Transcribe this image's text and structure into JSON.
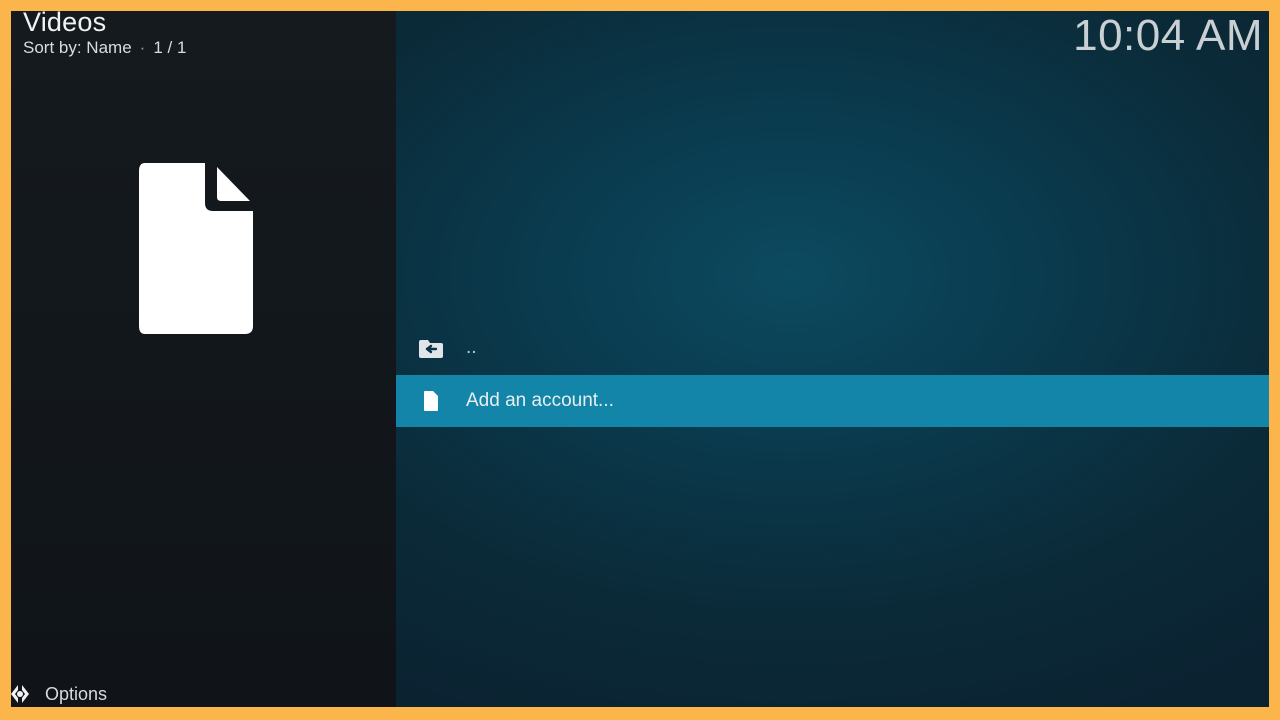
{
  "header": {
    "title": "Videos",
    "sort_label": "Sort by: Name",
    "separator": "·",
    "page_count": "1 / 1",
    "clock": "10:04 AM"
  },
  "thumbnail": {
    "icon": "file-icon"
  },
  "list": {
    "items": [
      {
        "label": "..",
        "icon": "folder-back-icon",
        "selected": false
      },
      {
        "label": "Add an account...",
        "icon": "file-icon",
        "selected": true
      }
    ]
  },
  "footer": {
    "options_label": "Options",
    "options_icon": "options-icon"
  },
  "colors": {
    "frame_border": "#fcb54a",
    "selection": "#1285a8",
    "left_panel": "#13181c",
    "background": "#0a3a4d"
  }
}
